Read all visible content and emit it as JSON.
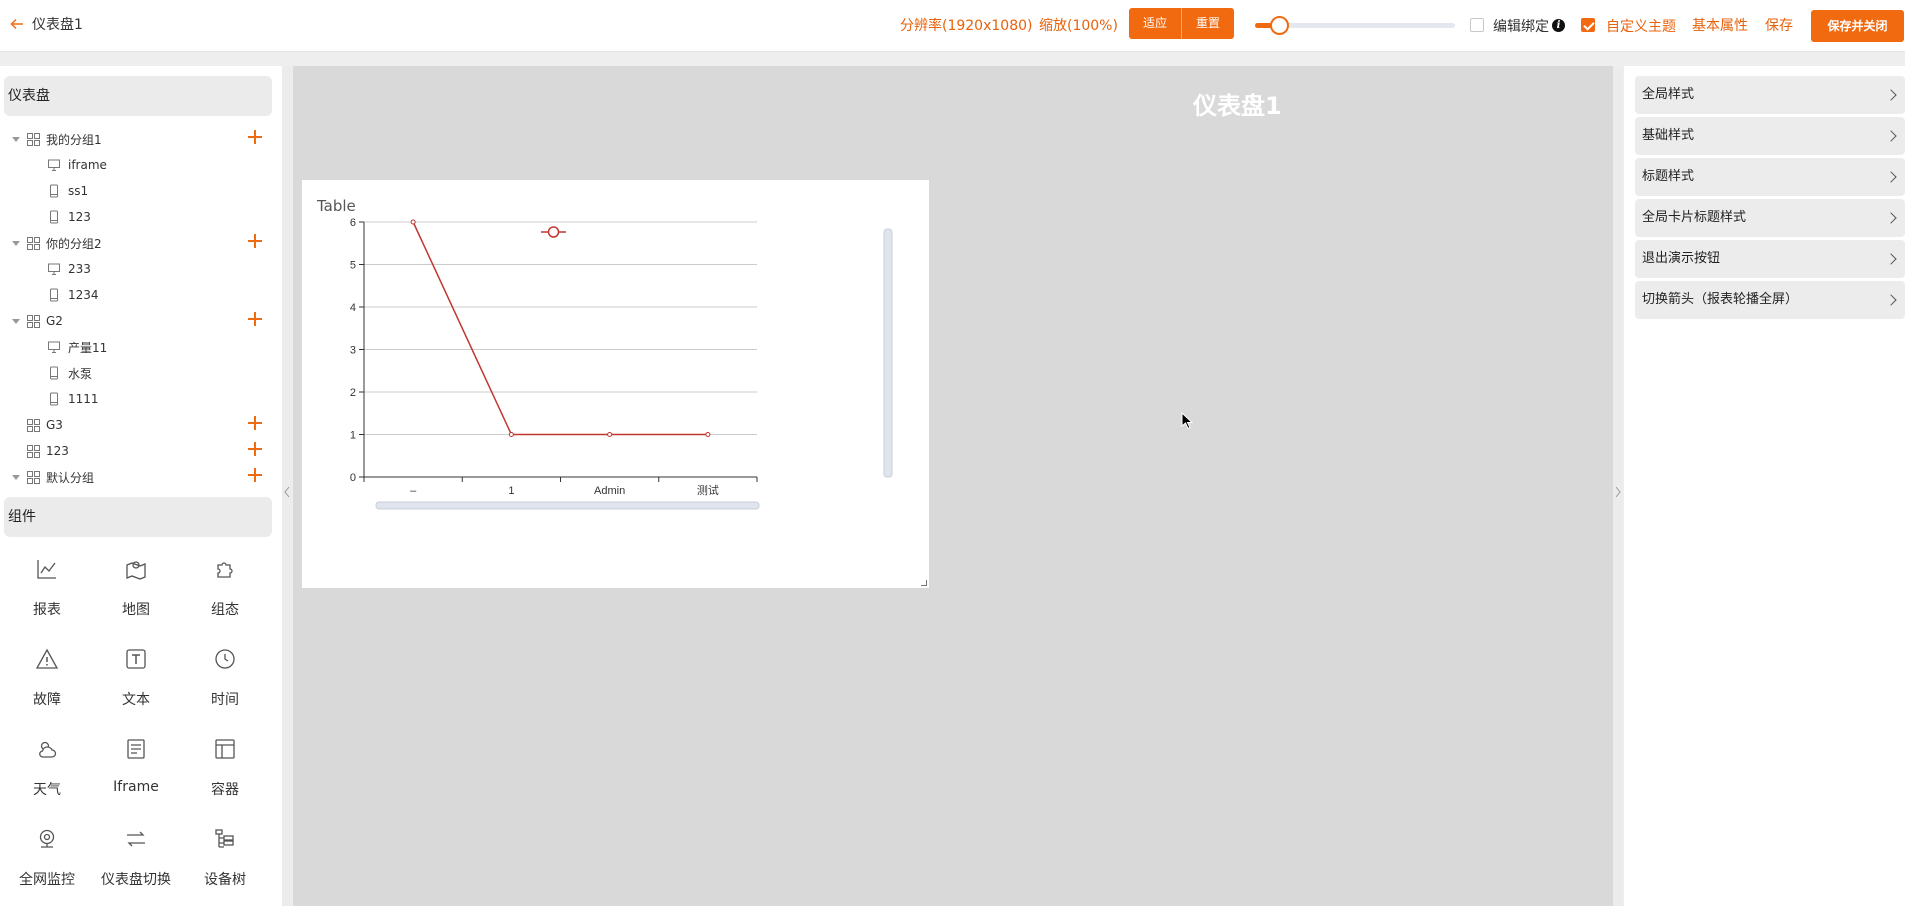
{
  "header": {
    "title": "仪表盘1",
    "resolution": "分辨率(1920x1080)",
    "zoom": "缩放(100%)",
    "fit_label": "适应",
    "reset_label": "重置",
    "zoom_slider_value": 0.12,
    "edit_bind_label": "编辑绑定",
    "edit_bind_checked": false,
    "custom_theme_label": "自定义主题",
    "custom_theme_checked": true,
    "basic_props_label": "基本属性",
    "save_label": "保存",
    "save_close_label": "保存并关闭",
    "accent_color": "#f26a10"
  },
  "left": {
    "dashboard_section": "仪表盘",
    "tree": [
      {
        "type": "group",
        "label": "我的分组1",
        "expanded": true
      },
      {
        "type": "screen",
        "icon": "monitor-icon",
        "label": "iframe"
      },
      {
        "type": "screen",
        "icon": "phone-icon",
        "label": "ss1"
      },
      {
        "type": "screen",
        "icon": "phone-icon",
        "label": "123"
      },
      {
        "type": "group",
        "label": "你的分组2",
        "expanded": true
      },
      {
        "type": "screen",
        "icon": "monitor-icon",
        "label": "233"
      },
      {
        "type": "screen",
        "icon": "phone-icon",
        "label": "1234"
      },
      {
        "type": "group",
        "label": "G2",
        "expanded": true
      },
      {
        "type": "screen",
        "icon": "monitor-icon",
        "label": "产量11"
      },
      {
        "type": "screen",
        "icon": "phone-icon",
        "label": "水泵"
      },
      {
        "type": "screen",
        "icon": "phone-icon",
        "label": "1111"
      },
      {
        "type": "group",
        "label": "G3",
        "expanded": false,
        "leaf": true
      },
      {
        "type": "group",
        "label": "123",
        "expanded": false,
        "leaf": true
      },
      {
        "type": "group",
        "label": "默认分组",
        "expanded": true
      }
    ],
    "components_section": "组件",
    "components": [
      {
        "label": "报表",
        "icon": "line-chart-icon"
      },
      {
        "label": "地图",
        "icon": "map-icon"
      },
      {
        "label": "组态",
        "icon": "puzzle-icon"
      },
      {
        "label": "故障",
        "icon": "warning-icon"
      },
      {
        "label": "文本",
        "icon": "text-icon"
      },
      {
        "label": "时间",
        "icon": "clock-icon"
      },
      {
        "label": "天气",
        "icon": "weather-icon"
      },
      {
        "label": "Iframe",
        "icon": "iframe-icon"
      },
      {
        "label": "容器",
        "icon": "container-icon"
      },
      {
        "label": "全网监控",
        "icon": "camera-icon"
      },
      {
        "label": "仪表盘切换",
        "icon": "switch-icon"
      },
      {
        "label": "设备树",
        "icon": "device-tree-icon"
      }
    ]
  },
  "canvas": {
    "title": "仪表盘1",
    "widget_title": "Table"
  },
  "chart_data": {
    "type": "line",
    "title": "Table",
    "categories": [
      "–",
      "1",
      "Admin",
      "测试"
    ],
    "series": [
      {
        "values": [
          6,
          1,
          1,
          1
        ],
        "color": "#c23531"
      }
    ],
    "ylim": [
      0,
      6
    ],
    "yticks": [
      0,
      1,
      2,
      3,
      4,
      5,
      6
    ],
    "grid": true,
    "xlabel": "",
    "ylabel": ""
  },
  "right": {
    "panels": [
      "全局样式",
      "基础样式",
      "标题样式",
      "全局卡片标题样式",
      "退出演示按钮",
      "切换箭头（报表轮播全屏）"
    ]
  }
}
